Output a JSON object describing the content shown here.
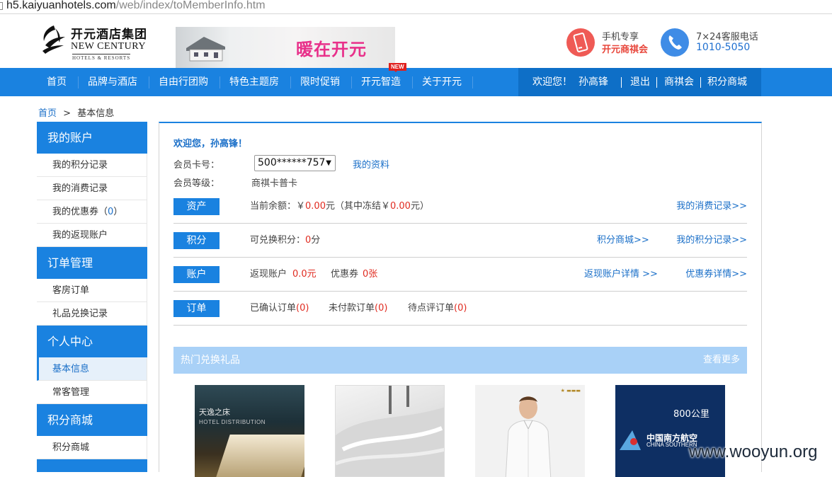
{
  "browser": {
    "url_host": "h5.kaiyuanhotels.com",
    "url_path": "/web/index/toMemberInfo.htm"
  },
  "header": {
    "logo_cn": "开元酒店集团",
    "logo_en": "NEW CENTURY",
    "logo_en_sub": "HOTELS & RESORTS",
    "banner_slogan": "暖在开元",
    "mobile_title": "手机专享",
    "mobile_name": "开元商祺会",
    "service_title": "7×24客服电话",
    "service_phone": "1010-5050"
  },
  "nav": {
    "items": [
      "首页",
      "品牌与酒店",
      "自由行团购",
      "特色主题房",
      "限时促销",
      "开元智造",
      "关于开元"
    ],
    "new_badge": "NEW",
    "welcome": "欢迎您！",
    "username": "孙高锋",
    "logout": "退出",
    "club": "商祺会",
    "points_mall": "积分商城"
  },
  "breadcrumb": {
    "home": "首页",
    "separator": ">",
    "current": "基本信息"
  },
  "sidebar": {
    "groups": [
      {
        "title": "我的账户",
        "items": [
          "我的积分记录",
          "我的消费记录",
          "我的优惠券（",
          "我的返现账户"
        ]
      },
      {
        "title": "订单管理",
        "items": [
          "客房订单",
          "礼品兑换记录"
        ]
      },
      {
        "title": "个人中心",
        "items": [
          "基本信息",
          "常客管理"
        ]
      },
      {
        "title": "积分商城",
        "items": [
          "积分商城"
        ]
      }
    ],
    "coupon_count": "0",
    "coupon_close": "）"
  },
  "main": {
    "welcome": "欢迎您，孙高锋！",
    "card_label": "会员卡号：",
    "card_number": "500******757",
    "my_profile": "我的资料",
    "level_label": "会员等级：",
    "level_value": "商祺卡普卡",
    "rows": {
      "assets": {
        "tag": "资产",
        "text1": "当前余额：￥",
        "balance": "0.00",
        "text2": "元（其中冻结￥",
        "frozen": "0.00",
        "text3": "元）",
        "link": "我的消费记录>>"
      },
      "points": {
        "tag": "积分",
        "text1": "可兑换积分：",
        "points": "0",
        "text2": "分",
        "link1": "积分商城>>",
        "link2": "我的积分记录>>"
      },
      "account": {
        "tag": "账户",
        "text1": "返现账户",
        "cash": "0.0元",
        "text2": "优惠券",
        "coupons": "0张",
        "link1": "返现账户详情 >>",
        "link2": "优惠券详情>>"
      },
      "orders": {
        "tag": "订单",
        "confirmed": "已确认订单",
        "confirmed_n": "(0)",
        "unpaid": "未付款订单",
        "unpaid_n": "(0)",
        "review": "待点评订单",
        "review_n": "(0)"
      }
    },
    "gifts": {
      "title": "热门兑换礼品",
      "more": "查看更多",
      "g1_caption": "天逸之床",
      "g1_caption_en": "HOTEL DISTRIBUTION",
      "g4_distance": "800公里",
      "g4_airline_cn": "中国南方航空",
      "g4_airline_en": "CHINA SOUTHERN"
    }
  },
  "watermark": "www.wooyun.org",
  "colors": {
    "primary": "#1a82e0",
    "nav_user_bg": "#0e6fc7",
    "red": "#e02b20",
    "link": "#1a6fc8"
  }
}
